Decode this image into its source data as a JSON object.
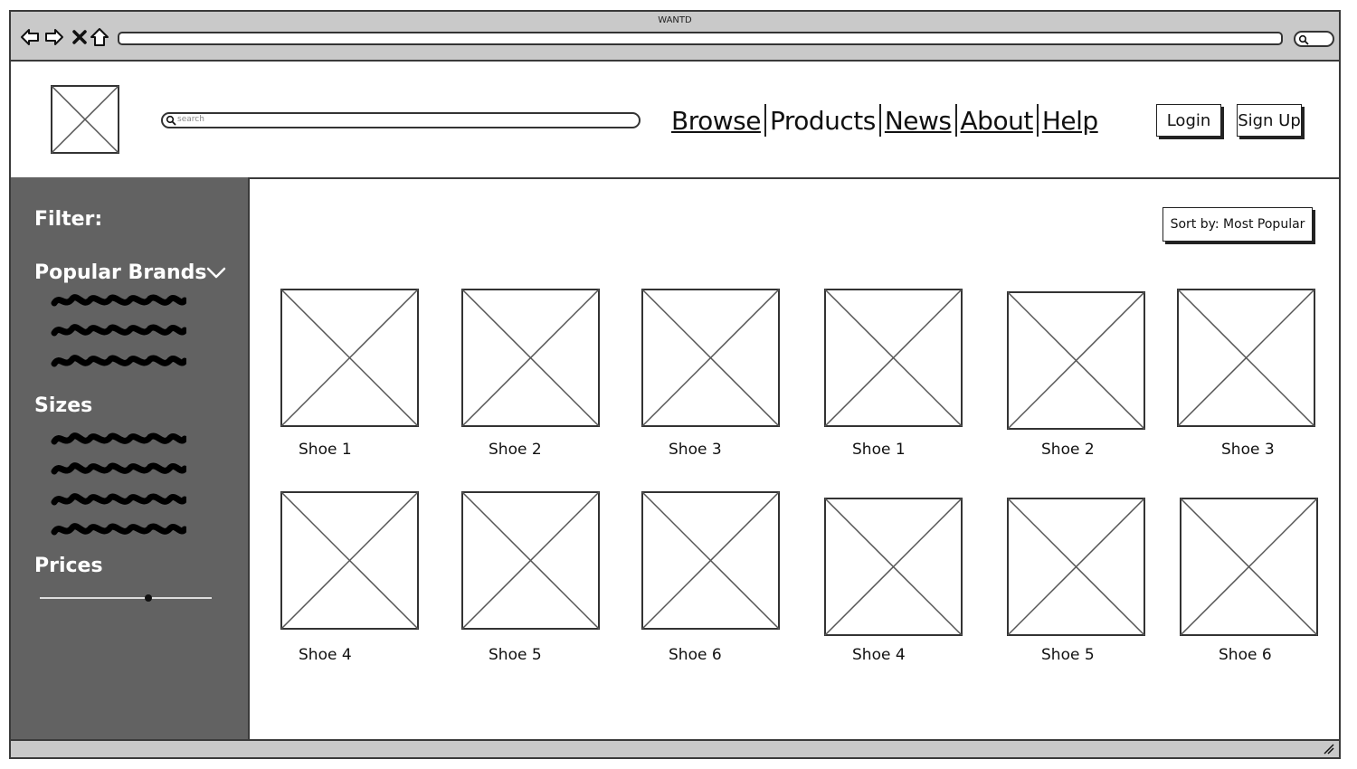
{
  "window": {
    "title": "WANTD"
  },
  "header": {
    "search_placeholder": "search",
    "nav": [
      "Browse",
      "Products",
      "News",
      "About",
      "Help"
    ],
    "login_label": "Login",
    "signup_label": "Sign Up"
  },
  "sidebar": {
    "filter_title": "Filter:",
    "brands_title": "Popular Brands",
    "sizes_title": "Sizes",
    "prices_title": "Prices",
    "price_slider_level": 0.63
  },
  "main": {
    "sort_label": "Sort by: Most Popular",
    "products": [
      {
        "label": "Shoe 1"
      },
      {
        "label": "Shoe 2"
      },
      {
        "label": "Shoe 3"
      },
      {
        "label": "Shoe 1"
      },
      {
        "label": "Shoe 2"
      },
      {
        "label": "Shoe 3"
      },
      {
        "label": "Shoe 4"
      },
      {
        "label": "Shoe 5"
      },
      {
        "label": "Shoe 6"
      },
      {
        "label": "Shoe 4"
      },
      {
        "label": "Shoe 5"
      },
      {
        "label": "Shoe 6"
      }
    ]
  }
}
